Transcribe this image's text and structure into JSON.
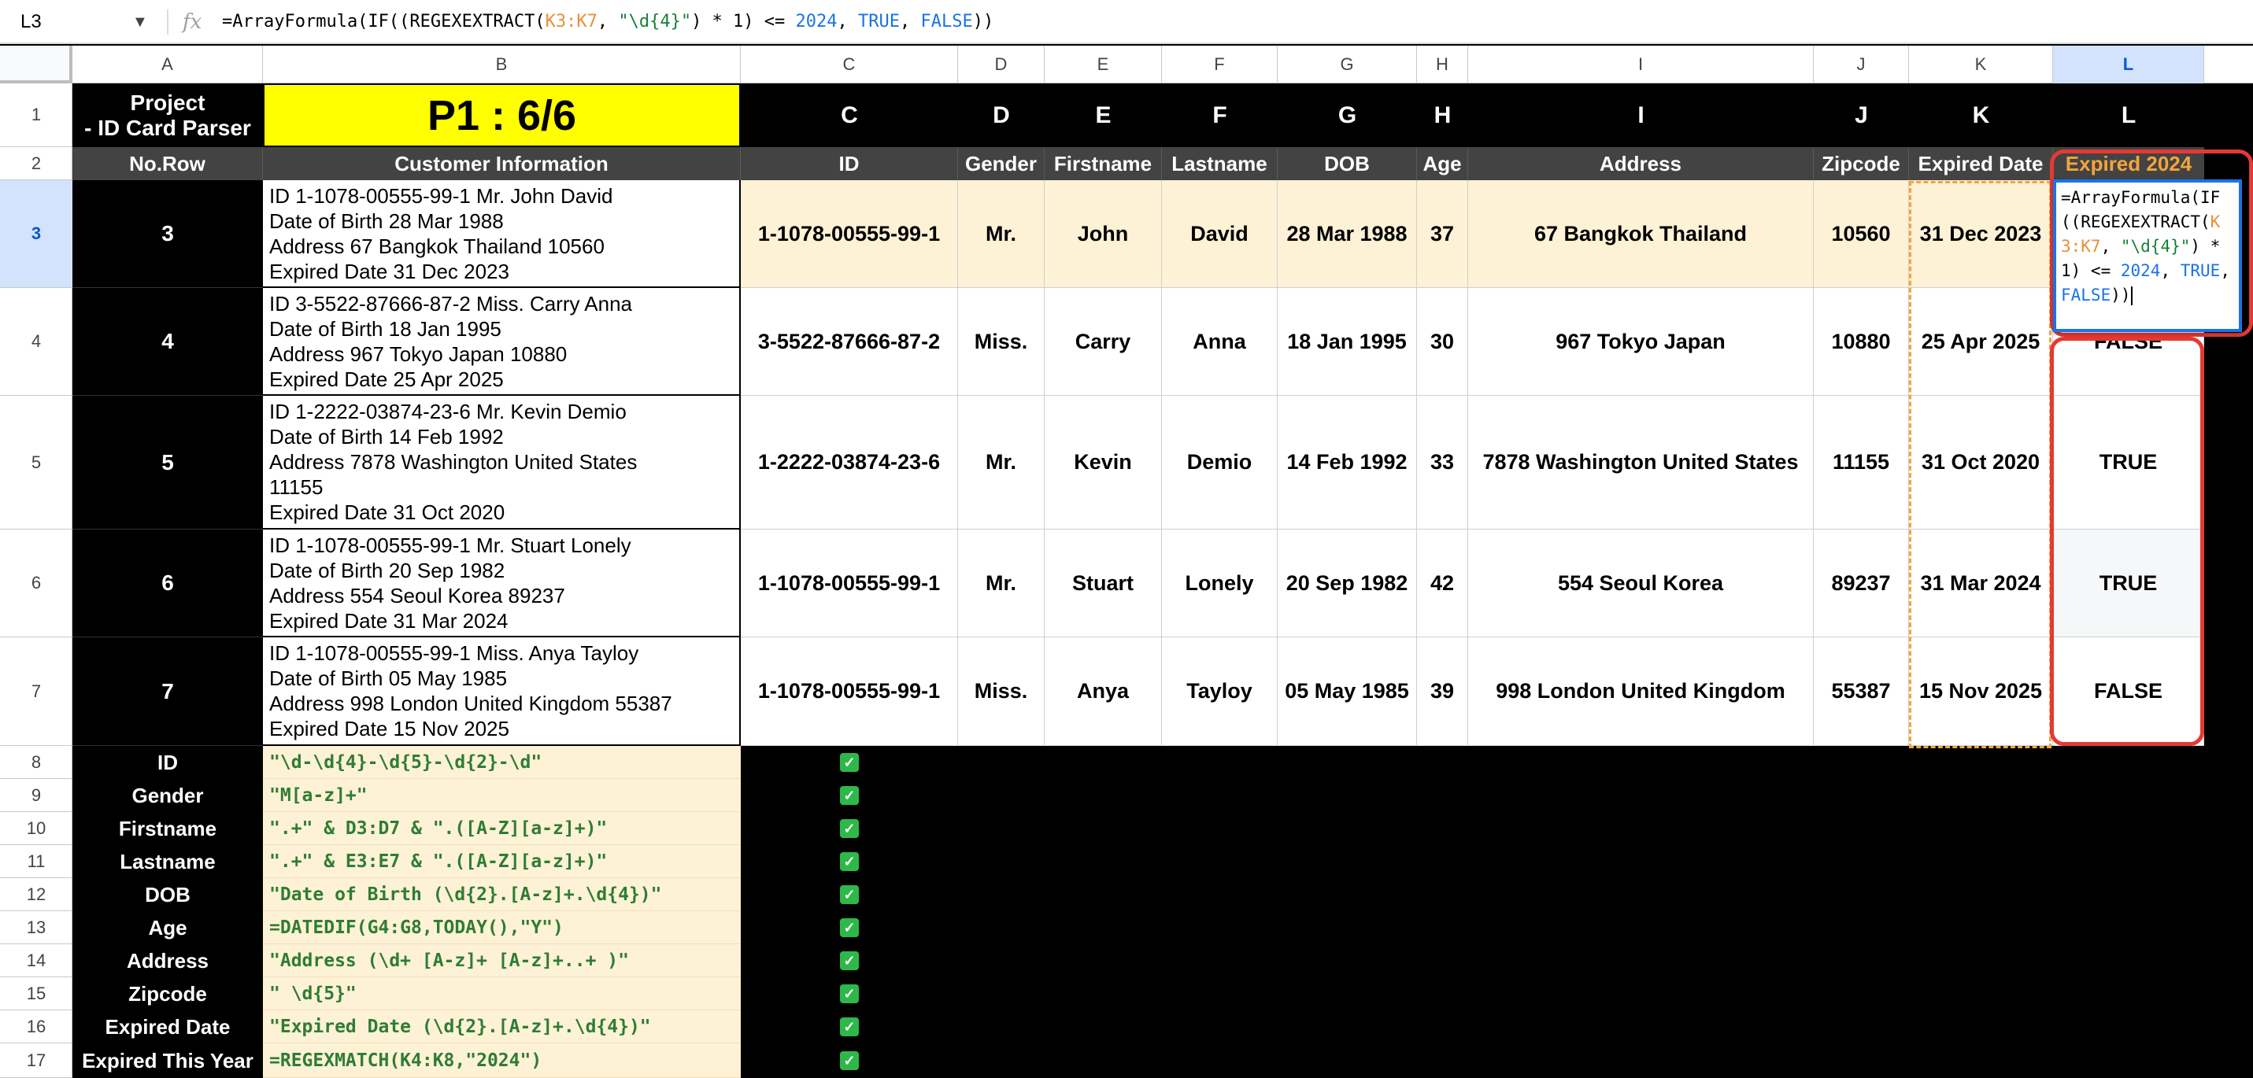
{
  "formula_bar": {
    "cell_ref": "L3",
    "fx_icon": "fx-icon",
    "formula_parts": [
      "=ArrayFormula(IF((REGEXEXTRACT(",
      "K3:K7",
      ", ",
      "\"\\d{4}\"",
      ") * 1) <= ",
      "2024",
      ", ",
      "TRUE",
      ", ",
      "FALSE",
      "))"
    ]
  },
  "columns": [
    "A",
    "B",
    "C",
    "D",
    "E",
    "F",
    "G",
    "H",
    "I",
    "J",
    "K",
    "L"
  ],
  "rows": [
    "1",
    "2",
    "3",
    "4",
    "5",
    "6",
    "7",
    "8",
    "9",
    "10",
    "11",
    "12",
    "13",
    "14",
    "15",
    "16",
    "17"
  ],
  "title": {
    "project_line1": "Project",
    "project_line2": "- ID Card Parser",
    "p_label": "P1 : 6/6"
  },
  "row1_letters": [
    "C",
    "D",
    "E",
    "F",
    "G",
    "H",
    "I",
    "J",
    "K",
    "L"
  ],
  "headers": [
    "No.Row",
    "Customer Information",
    "ID",
    "Gender",
    "Firstname",
    "Lastname",
    "DOB",
    "Age",
    "Address",
    "Zipcode",
    "Expired Date",
    "Expired 2024"
  ],
  "records": [
    {
      "no": "3",
      "info": [
        "ID 1-1078-00555-99-1 Mr. John David",
        "Date of Birth 28 Mar 1988",
        "Address 67 Bangkok Thailand 10560",
        "Expired Date 31 Dec 2023"
      ],
      "id": "1-1078-00555-99-1",
      "gender": "Mr.",
      "firstname": "John",
      "lastname": "David",
      "dob": "28 Mar 1988",
      "age": "37",
      "address": "67 Bangkok Thailand",
      "zipcode": "10560",
      "expired": "31 Dec 2023",
      "expired_2024": ""
    },
    {
      "no": "4",
      "info": [
        "ID 3-5522-87666-87-2 Miss. Carry Anna",
        "Date of Birth 18 Jan 1995",
        "Address 967 Tokyo Japan 10880",
        "Expired Date 25 Apr 2025"
      ],
      "id": "3-5522-87666-87-2",
      "gender": "Miss.",
      "firstname": "Carry",
      "lastname": "Anna",
      "dob": "18 Jan 1995",
      "age": "30",
      "address": "967 Tokyo Japan",
      "zipcode": "10880",
      "expired": "25 Apr 2025",
      "expired_2024": "FALSE"
    },
    {
      "no": "5",
      "info": [
        "ID 1-2222-03874-23-6 Mr. Kevin Demio",
        "Date of Birth 14 Feb 1992",
        "Address 7878 Washington United States",
        "11155",
        "Expired Date 31 Oct 2020"
      ],
      "id": "1-2222-03874-23-6",
      "gender": "Mr.",
      "firstname": "Kevin",
      "lastname": "Demio",
      "dob": "14 Feb 1992",
      "age": "33",
      "address": "7878 Washington United States",
      "zipcode": "11155",
      "expired": "31 Oct 2020",
      "expired_2024": "TRUE"
    },
    {
      "no": "6",
      "info": [
        "ID 1-1078-00555-99-1 Mr. Stuart Lonely",
        "Date of Birth 20 Sep 1982",
        "Address 554 Seoul Korea 89237",
        "Expired Date 31 Mar 2024"
      ],
      "id": "1-1078-00555-99-1",
      "gender": "Mr.",
      "firstname": "Stuart",
      "lastname": "Lonely",
      "dob": "20 Sep 1982",
      "age": "42",
      "address": "554 Seoul Korea",
      "zipcode": "89237",
      "expired": "31 Mar 2024",
      "expired_2024": "TRUE"
    },
    {
      "no": "7",
      "info": [
        "ID 1-1078-00555-99-1 Miss. Anya Tayloy",
        "Date of Birth 05 May 1985",
        "Address 998 London United Kingdom 55387",
        "Expired Date 15 Nov 2025"
      ],
      "id": "1-1078-00555-99-1",
      "gender": "Miss.",
      "firstname": "Anya",
      "lastname": "Tayloy",
      "dob": "05 May 1985",
      "age": "39",
      "address": "998 London United Kingdom",
      "zipcode": "55387",
      "expired": "15 Nov 2025",
      "expired_2024": "FALSE"
    }
  ],
  "patterns": [
    {
      "label": "ID",
      "pattern": "\"\\d-\\d{4}-\\d{5}-\\d{2}-\\d\"",
      "check": "✓"
    },
    {
      "label": "Gender",
      "pattern": "\"M[a-z]+\"",
      "check": "✓"
    },
    {
      "label": "Firstname",
      "pattern": "\".+\" & D3:D7 & \".([A-Z][a-z]+)\"",
      "check": "✓"
    },
    {
      "label": "Lastname",
      "pattern": "\".+\" & E3:E7 & \".([A-Z][a-z]+)\"",
      "check": "✓"
    },
    {
      "label": "DOB",
      "pattern": "\"Date of Birth (\\d{2}.[A-z]+.\\d{4})\"",
      "check": "✓"
    },
    {
      "label": "Age",
      "pattern": "=DATEDIF(G4:G8,TODAY(),\"Y\")",
      "check": "✓"
    },
    {
      "label": "Address",
      "pattern": "\"Address (\\d+ [A-z]+ [A-z]+..+ )\"",
      "check": "✓"
    },
    {
      "label": "Zipcode",
      "pattern": "\" \\d{5}\"",
      "check": "✓"
    },
    {
      "label": "Expired Date",
      "pattern": "\"Expired Date (\\d{2}.[A-z]+.\\d{4})\"",
      "check": "✓"
    },
    {
      "label": "Expired This Year",
      "pattern": "=REGEXMATCH(K4:K8,\"2024\")",
      "check": "✓"
    }
  ],
  "colors": {
    "accent_blue": "#1a73e8",
    "highlight_yellow": "#ffff00",
    "row_tint": "#fdf1d6",
    "annotation_red": "#e53935",
    "header_orange": "#f3a43c",
    "pattern_green": "#2e7d32"
  }
}
